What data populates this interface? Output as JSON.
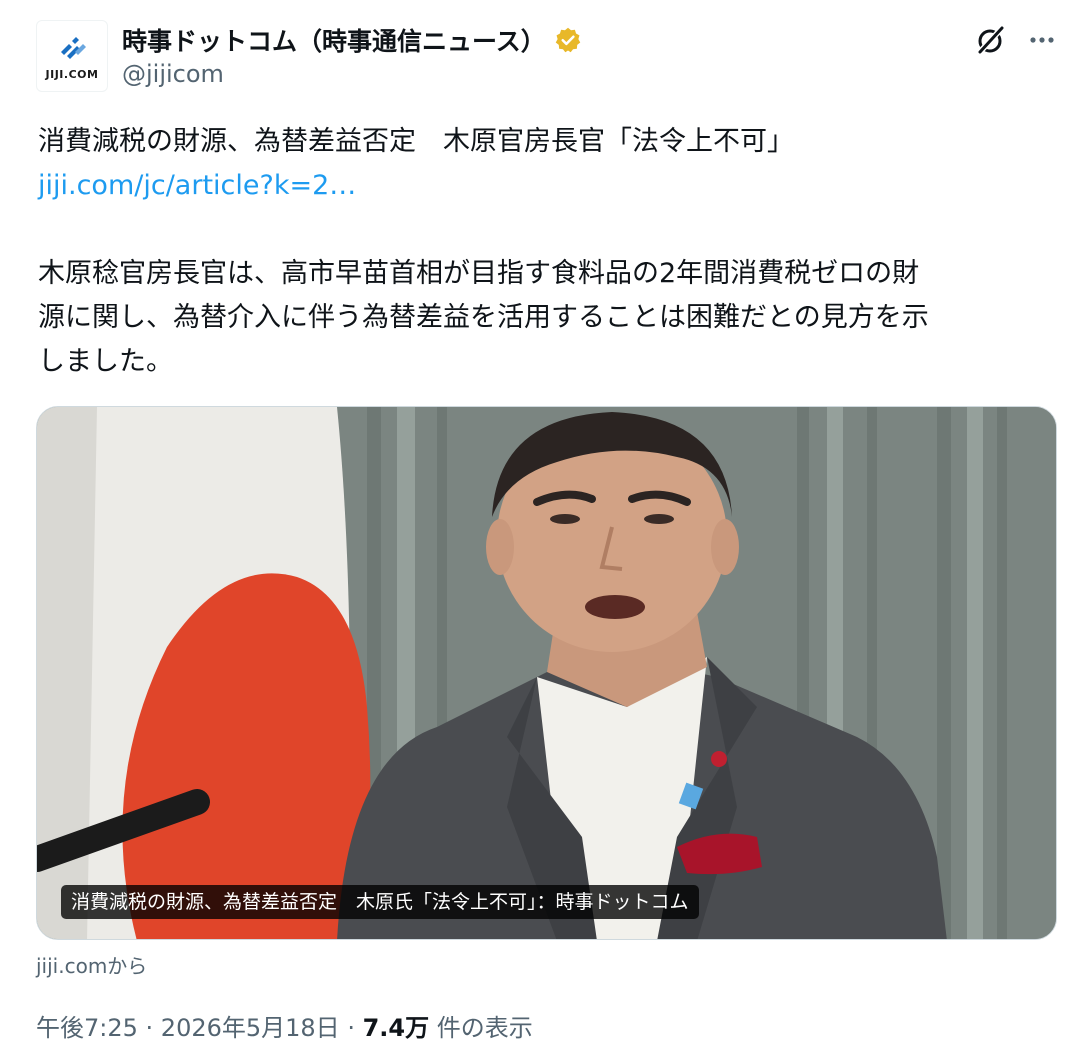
{
  "author": {
    "display_name": "時事ドットコム（時事通信ニュース）",
    "handle": "@jijicom",
    "avatar_text": "JIJI.COM",
    "verified_icon": "gold-verified-badge",
    "brand_color": "#1a6fc2",
    "verified_color": "#e8b829"
  },
  "actions": {
    "grok_icon": "grok-icon",
    "more_icon": "more-dots-icon"
  },
  "tweet": {
    "line1": "消費減税の財源、為替差益否定　木原官房長官「法令上不可」",
    "link": "jiji.com/jc/article?k=2…",
    "body_line1": "木原稔官房長官は、高市早苗首相が目指す食料品の2年間消費税ゼロの財",
    "body_line2": "源に関し、為替介入に伴う為替差益を活用することは困難だとの見方を示",
    "body_line3": "しました。",
    "link_color": "#1d9bf0"
  },
  "card": {
    "caption": "消費減税の財源、為替差益否定　木原氏「法令上不可」：時事ドットコム",
    "source": "jiji.comから"
  },
  "meta": {
    "time": "午後7:25",
    "sep1": " · ",
    "date": "2026年5月18日",
    "sep2": " · ",
    "views_count": "7.4万",
    "views_label": " 件の表示"
  }
}
